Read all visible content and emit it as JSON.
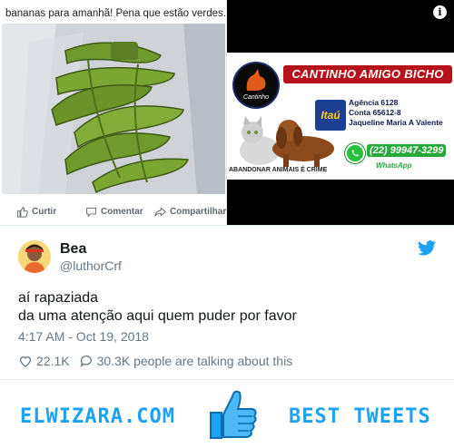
{
  "fb_post": {
    "caption": "bananas para amanhã! Pena que estão verdes. 😢",
    "actions": {
      "like": "Curtir",
      "comment": "Comentar",
      "share": "Compartilhar"
    }
  },
  "ad": {
    "info_icon": "i",
    "title": "CANTINHO AMIGO BICHO",
    "logo_text": "Cantinho",
    "bank": "Itaú",
    "agency": "Agência 6128",
    "account": "Conta 65612-8",
    "holder": "Jaqueline Maria A Valente",
    "phone": "(22) 99947-3299",
    "whatsapp": "WhatsApp",
    "slogan": "ABANDONAR ANIMAIS É CRIME"
  },
  "tweet": {
    "name": "Bea",
    "handle": "@luthorCrf",
    "text_line1": "aí rapaziada",
    "text_line2": "da uma atenção aqui quem puder por favor",
    "timestamp": "4:17 AM - Oct 19, 2018",
    "likes": "22.1K",
    "talking": "30.3K people are talking about this"
  },
  "footer": {
    "site": "ELWIZARA.COM",
    "tag": "BEST TWEETS"
  },
  "colors": {
    "twitter_blue": "#1da1f2",
    "ad_red": "#b5121b",
    "itau_blue": "#1c3f94",
    "whatsapp_green": "#25c13c"
  },
  "icons": [
    "like-icon",
    "comment-icon",
    "share-icon",
    "info-icon",
    "twitter-bird-icon",
    "heart-icon",
    "reply-icon",
    "thumbs-up-icon",
    "whatsapp-icon"
  ]
}
